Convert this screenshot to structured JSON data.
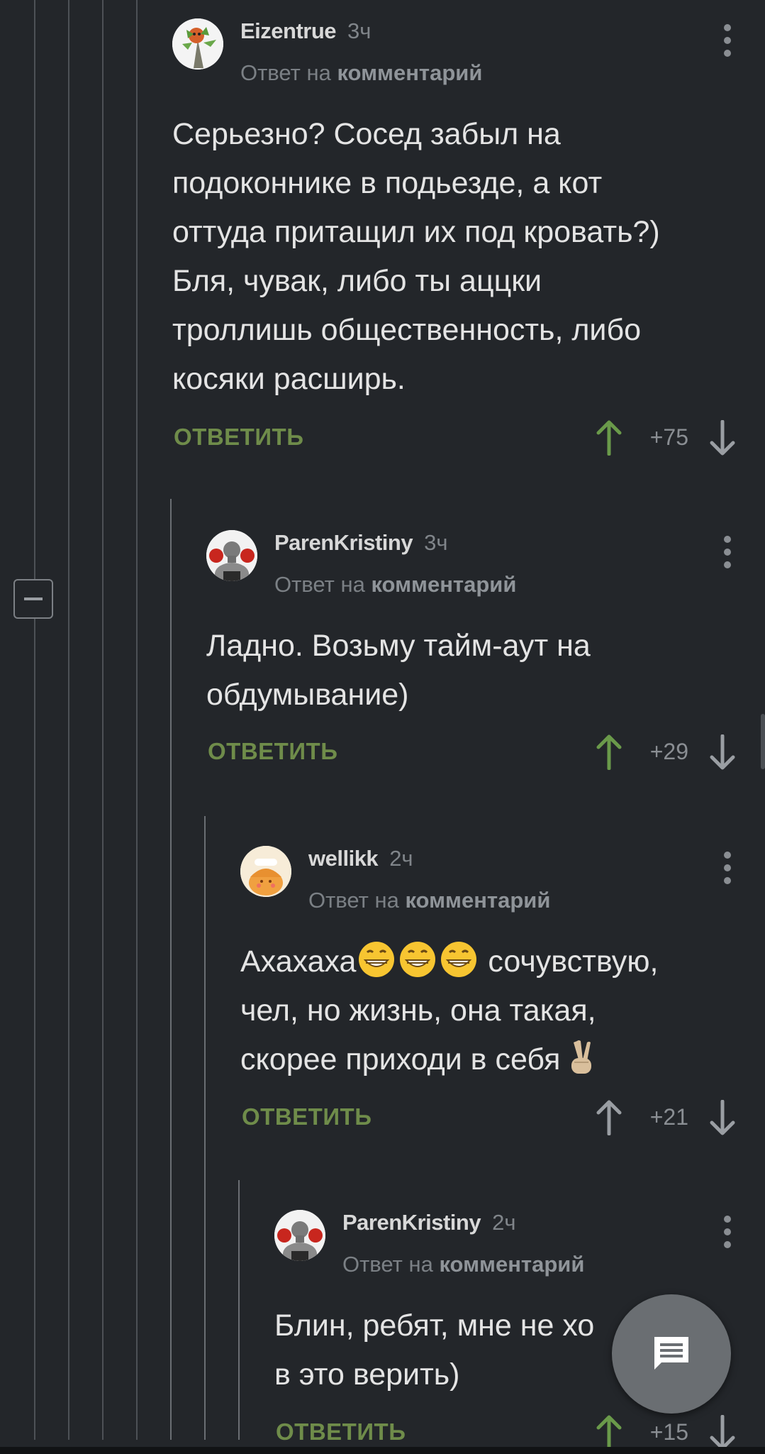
{
  "comments": [
    {
      "username": "Eizentrue",
      "time": "3ч",
      "reply_prefix": "Ответ на",
      "reply_target": "комментарий",
      "text": "Серьезно? Сосед забыл на\nподоконнике в подьезде, а кот\nоттуда притащил их под кровать?)\nБля, чувак, либо ты аццки\nтроллишь общественность, либо\nкосяки расширь.",
      "reply_label": "ОТВЕТИТЬ",
      "votes": "+75",
      "upvoted": true,
      "avatar_icon": "plant-creature-avatar"
    },
    {
      "username": "ParenKristiny",
      "time": "3ч",
      "reply_prefix": "Ответ на",
      "reply_target": "комментарий",
      "text": "Ладно. Возьму тайм-аут на\nобдумывание)",
      "reply_label": "ОТВЕТИТЬ",
      "votes": "+29",
      "upvoted": true,
      "avatar_icon": "boxer-avatar"
    },
    {
      "username": "wellikk",
      "time": "2ч",
      "reply_prefix": "Ответ на",
      "reply_target": "комментарий",
      "text_line1_a": "Ахахаха",
      "text_line1_b": " сочувствую,",
      "text_line2": "чел, но жизнь, она такая,",
      "text_line3": "скорее приходи в себя",
      "emoji_icons": [
        "grinning-face-emoji",
        "victory-hand-emoji"
      ],
      "reply_label": "ОТВЕТИТЬ",
      "votes": "+21",
      "upvoted": false,
      "avatar_icon": "cartoon-girl-avatar"
    },
    {
      "username": "ParenKristiny",
      "time": "2ч",
      "reply_prefix": "Ответ на",
      "reply_target": "комментарий",
      "text": "Блин, ребят, мне не хо\nв это верить)",
      "reply_label": "ОТВЕТИТЬ",
      "votes": "+15",
      "upvoted": true,
      "avatar_icon": "boxer-avatar"
    }
  ],
  "colors": {
    "background": "#23262a",
    "reply_green": "#6f8c4a",
    "upvote_green": "#6a9a4a",
    "muted": "#8a8e93"
  },
  "fab_icon": "comment-icon"
}
